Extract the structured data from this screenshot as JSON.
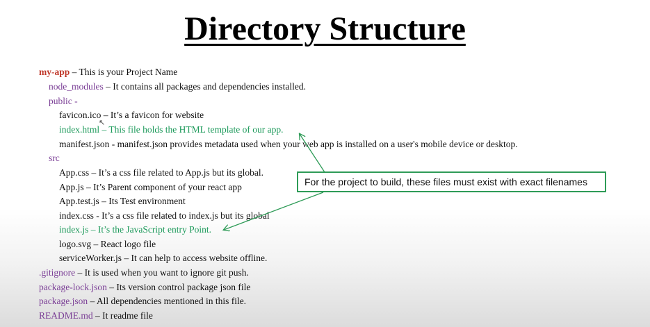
{
  "title": "Directory Structure",
  "callout": "For the project to build, these files must exist with exact filenames",
  "entries": [
    {
      "name": "my-app",
      "desc": " – This is your Project Name"
    },
    {
      "name": "node_modules",
      "desc": " – It contains all packages and dependencies installed."
    },
    {
      "name": "public -",
      "desc": ""
    },
    {
      "name": "favicon.ico",
      "desc": " – It’s a favicon for website"
    },
    {
      "name": "index.html",
      "desc": " – This file holds the HTML template of our app."
    },
    {
      "name": "manifest.json",
      "desc": " - manifest.json provides metadata used when your web app is installed on a user's mobile device or desktop."
    },
    {
      "name": "src",
      "desc": ""
    },
    {
      "name": "App.css",
      "desc": " – It’s a css file related to App.js but its global."
    },
    {
      "name": "App.js",
      "desc": " – It’s Parent component of your react app"
    },
    {
      "name": "App.test.js",
      "desc": " – Its Test environment"
    },
    {
      "name": "index.css",
      "desc": " - It’s a css file related to index.js but its global"
    },
    {
      "name": "index.js",
      "desc": " – It’s the JavaScript entry Point."
    },
    {
      "name": "logo.svg",
      "desc": " – React logo file"
    },
    {
      "name": "serviceWorker.js",
      "desc": " – It can help to access website offline."
    },
    {
      "name": ".gitignore",
      "desc": " – It is used when you want to ignore git push."
    },
    {
      "name": "package-lock.json",
      "desc": " – Its version control package json file"
    },
    {
      "name": "package.json",
      "desc": " – All dependencies mentioned in this file."
    },
    {
      "name": "README.md",
      "desc": " – It readme file"
    }
  ]
}
